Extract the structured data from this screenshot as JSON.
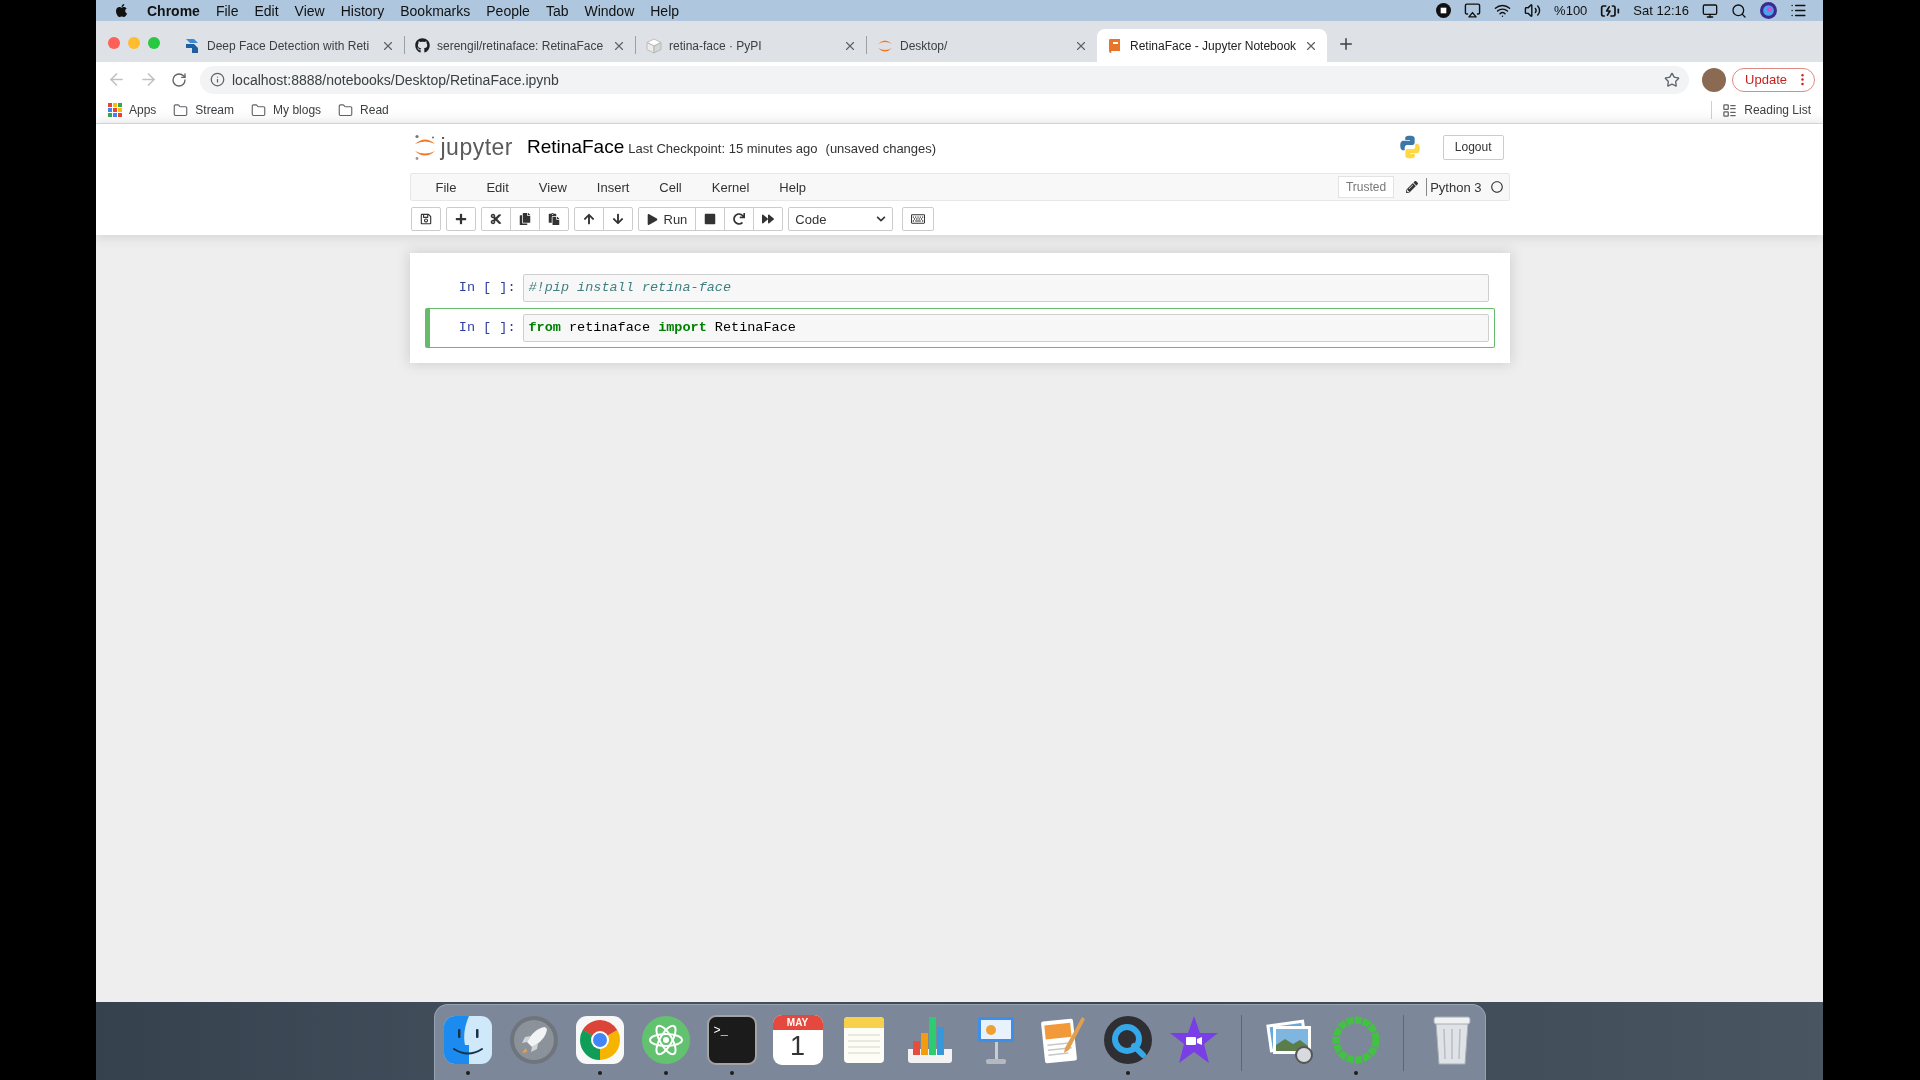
{
  "system_menu_bar": {
    "app": "Chrome",
    "menus": [
      "File",
      "Edit",
      "View",
      "History",
      "Bookmarks",
      "People",
      "Tab",
      "Window",
      "Help"
    ],
    "battery": "%100",
    "clock": "Sat 12:16"
  },
  "browser": {
    "tabs": [
      {
        "kind": "s-logo",
        "title": "Deep Face Detection with Reti",
        "selected": false
      },
      {
        "kind": "cat",
        "title": "serengil/retinaface: RetinaFace",
        "selected": false
      },
      {
        "kind": "cube",
        "title": "retina-face · PyPI",
        "selected": false
      },
      {
        "kind": "arcs",
        "title": "Desktop/",
        "selected": false
      },
      {
        "kind": "book",
        "title": "RetinaFace - Jupyter Notebook",
        "selected": true
      }
    ],
    "back": {
      "disabled": true
    },
    "forward": {
      "disabled": true
    },
    "address": "localhost:8888/notebooks/Desktop/RetinaFace.ipynb",
    "update_button": "Update",
    "bookmarks": [
      {
        "kind": "grid",
        "label": "Apps"
      },
      {
        "kind": "folder",
        "label": "Stream"
      },
      {
        "kind": "folder",
        "label": "My blogs"
      },
      {
        "kind": "folder",
        "label": "Read"
      }
    ],
    "reading_list": "Reading List"
  },
  "notebook": {
    "logo_text": "jupyter",
    "name": "RetinaFace",
    "checkpoint": "Last Checkpoint: 15 minutes ago",
    "save_status": "(unsaved changes)",
    "logout": "Logout",
    "menus": [
      "File",
      "Edit",
      "View",
      "Insert",
      "Cell",
      "Kernel",
      "Help"
    ],
    "trusted": "Trusted",
    "kernel": "Python 3",
    "kernel_busy": false,
    "toolbar": [
      {
        "buttons": [
          {
            "kind": "save"
          }
        ]
      },
      {
        "buttons": [
          {
            "kind": "add"
          }
        ]
      },
      {
        "buttons": [
          {
            "kind": "cut"
          },
          {
            "kind": "copy"
          },
          {
            "kind": "paste"
          }
        ]
      },
      {
        "buttons": [
          {
            "kind": "move-up"
          },
          {
            "kind": "move-down"
          }
        ]
      },
      {
        "buttons": [
          {
            "kind": "run",
            "label": "Run"
          },
          {
            "kind": "stop"
          },
          {
            "kind": "restart"
          },
          {
            "kind": "run-all"
          }
        ]
      },
      {
        "buttons": [
          {
            "kind": "select",
            "value": "Code"
          }
        ]
      },
      {
        "buttons": [
          {
            "kind": "keyboard"
          }
        ]
      }
    ],
    "cells": [
      {
        "prompt": "In [ ]:",
        "selected": false,
        "tokens": [
          {
            "kind": "comment",
            "text": "#!pip install retina-face"
          }
        ]
      },
      {
        "prompt": "In [ ]:",
        "selected": true,
        "tokens": [
          {
            "kind": "keyword",
            "text": "from"
          },
          {
            "kind": "name",
            "text": "retinaface"
          },
          {
            "kind": "keyword",
            "text": "import"
          },
          {
            "kind": "name",
            "text": "RetinaFace"
          }
        ]
      }
    ]
  },
  "dock": {
    "sections": [
      {
        "items": [
          {
            "kind": "face",
            "running": true
          },
          {
            "kind": "rocket",
            "running": false
          },
          {
            "kind": "wheel",
            "running": true
          },
          {
            "kind": "atom",
            "running": true
          },
          {
            "kind": "terminal",
            "running": true,
            "prompt": ">_"
          },
          {
            "kind": "calendar",
            "running": false,
            "month": "MAY",
            "day": "1"
          },
          {
            "kind": "notepad",
            "running": false
          },
          {
            "kind": "bars",
            "running": false
          },
          {
            "kind": "lectern",
            "running": false
          },
          {
            "kind": "document",
            "running": false
          },
          {
            "kind": "q-lens",
            "running": true
          },
          {
            "kind": "star",
            "running": false
          }
        ]
      },
      {
        "items": [
          {
            "kind": "photos",
            "running": false
          },
          {
            "kind": "ring",
            "running": true
          }
        ]
      },
      {
        "items": [
          {
            "kind": "trash",
            "running": false
          }
        ]
      }
    ]
  }
}
